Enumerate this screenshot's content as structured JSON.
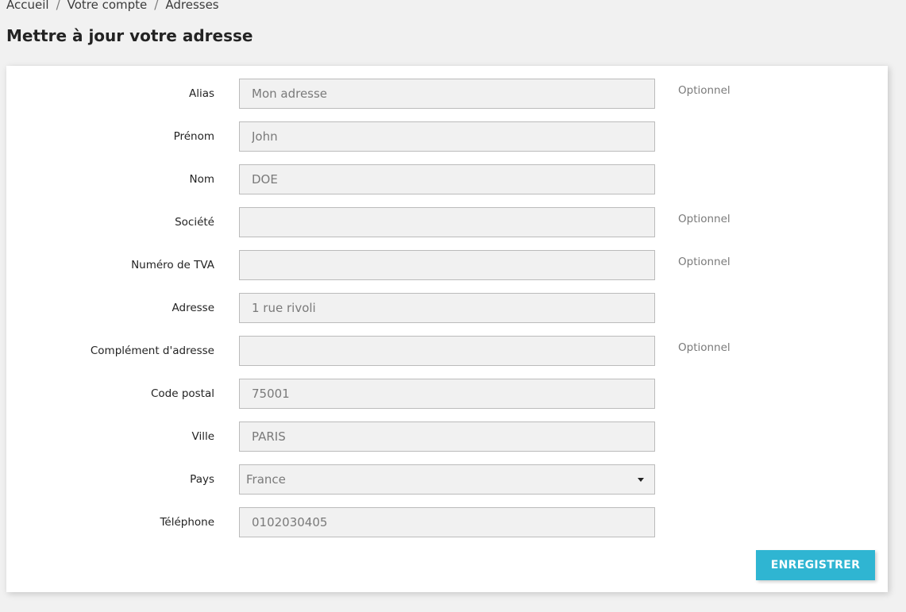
{
  "breadcrumb": {
    "items": [
      "Accueil",
      "Votre compte",
      "Adresses"
    ],
    "separator": "/"
  },
  "page": {
    "title": "Mettre à jour votre adresse"
  },
  "form": {
    "optional_label": "Optionnel",
    "fields": {
      "alias": {
        "label": "Alias",
        "value": "Mon adresse"
      },
      "firstname": {
        "label": "Prénom",
        "value": "John"
      },
      "lastname": {
        "label": "Nom",
        "value": "DOE"
      },
      "company": {
        "label": "Société",
        "value": ""
      },
      "vat_number": {
        "label": "Numéro de TVA",
        "value": ""
      },
      "address1": {
        "label": "Adresse",
        "value": "1 rue rivoli"
      },
      "address2": {
        "label": "Complément d'adresse",
        "value": ""
      },
      "postcode": {
        "label": "Code postal",
        "value": "75001"
      },
      "city": {
        "label": "Ville",
        "value": "PARIS"
      },
      "country": {
        "label": "Pays",
        "value": "France"
      },
      "phone": {
        "label": "Téléphone",
        "value": "0102030405"
      }
    },
    "save_label": "ENREGISTRER"
  },
  "colors": {
    "background": "#f1f1f1",
    "card": "#ffffff",
    "input_background": "#f1f1f1",
    "input_border": "#bbbbbb",
    "accent": "#2fb5d2",
    "text": "#232323",
    "muted_text": "#7a7a7a"
  }
}
